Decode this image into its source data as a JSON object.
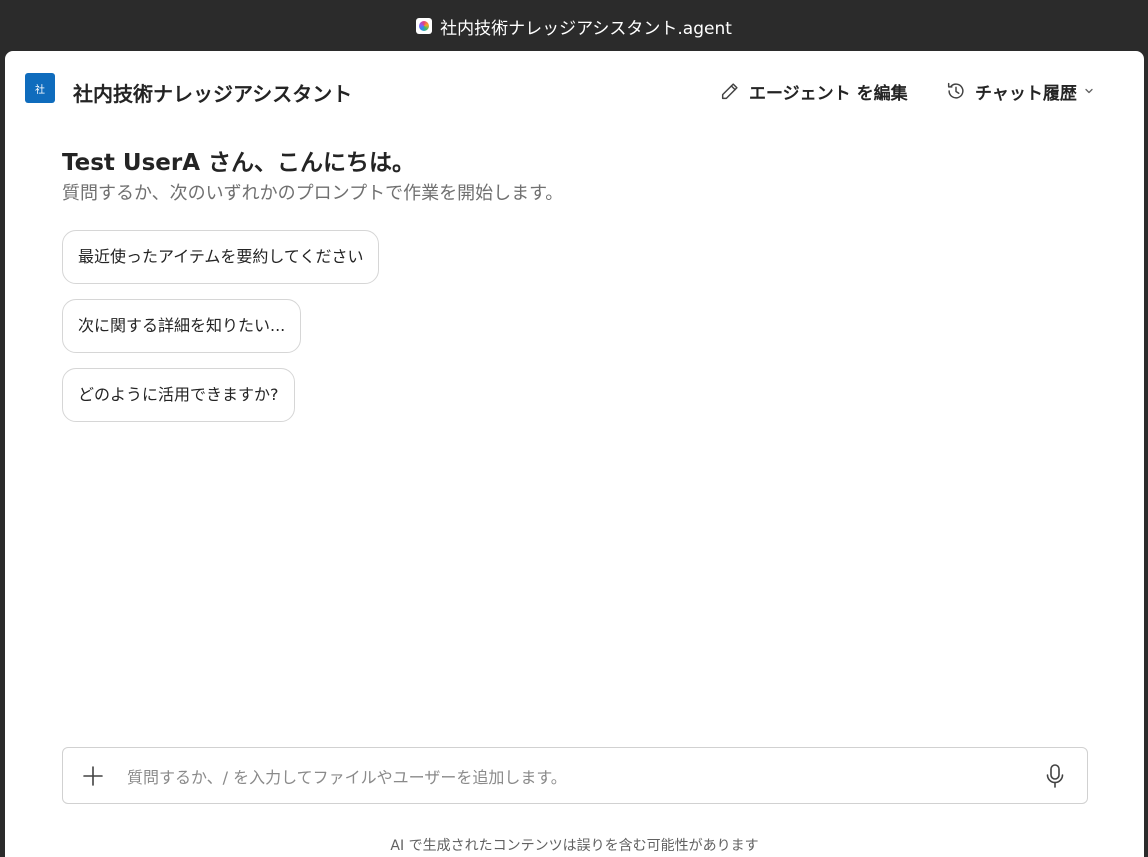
{
  "window": {
    "title": "社内技術ナレッジアシスタント.agent",
    "app_icon": "copilot-icon"
  },
  "header": {
    "logo_text": "社",
    "agent_name": "社内技術ナレッジアシスタント",
    "edit_label": "エージェント を編集",
    "history_label": "チャット履歴"
  },
  "main": {
    "greeting": "Test UserA さん、こんにちは。",
    "subtitle": "質問するか、次のいずれかのプロンプトで作業を開始します。",
    "prompts": [
      {
        "label": "最近使ったアイテムを要約してください"
      },
      {
        "label": "次に関する詳細を知りたい..."
      },
      {
        "label": "どのように活用できますか?"
      }
    ]
  },
  "composer": {
    "placeholder": "質問するか、/ を入力してファイルやユーザーを追加します。",
    "value": ""
  },
  "footer": {
    "disclaimer": "AI で生成されたコンテンツは誤りを含む可能性があります"
  },
  "colors": {
    "brand": "#0f6cbd",
    "text": "#242424",
    "muted": "#707070",
    "border": "#d6d6d6",
    "window_chrome": "#2b2b2b"
  }
}
